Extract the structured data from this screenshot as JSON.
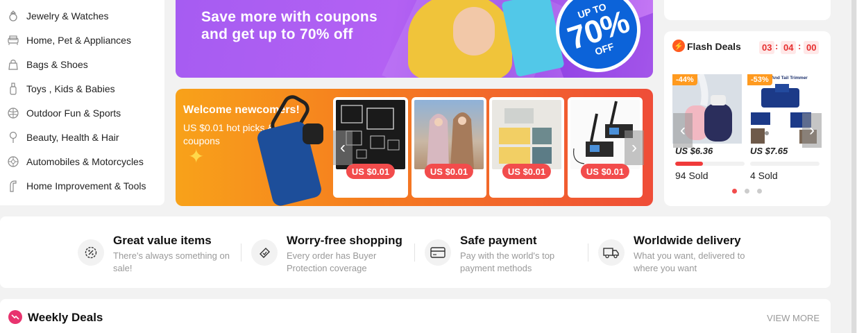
{
  "sidebar": {
    "categories": [
      {
        "label": "Jewelry & Watches",
        "icon": "ring-icon"
      },
      {
        "label": "Home, Pet & Appliances",
        "icon": "sofa-icon"
      },
      {
        "label": "Bags & Shoes",
        "icon": "bag-icon"
      },
      {
        "label": "Toys , Kids & Babies",
        "icon": "bottle-icon"
      },
      {
        "label": "Outdoor Fun & Sports",
        "icon": "ball-icon"
      },
      {
        "label": "Beauty, Health & Hair",
        "icon": "beauty-icon"
      },
      {
        "label": "Automobiles & Motorcycles",
        "icon": "wheel-icon"
      },
      {
        "label": "Home Improvement & Tools",
        "icon": "tool-icon"
      }
    ]
  },
  "hero": {
    "line1": "Save more with coupons",
    "line2": "and get up to 70% off",
    "badge_upto": "UP TO",
    "badge_pct": "70%",
    "badge_off": "OFF"
  },
  "welcome": {
    "title": "Welcome newcomers!",
    "subtitle": "US $0.01 hot picks & coupons",
    "products": [
      {
        "price": "US $0.01",
        "image": "acrylic-boxes"
      },
      {
        "price": "US $0.01",
        "image": "hijab-scarves"
      },
      {
        "price": "US $0.01",
        "image": "storage-boxes"
      },
      {
        "price": "US $0.01",
        "image": "lora-board"
      }
    ]
  },
  "flash": {
    "title": "Flash Deals",
    "timer": {
      "h": "03",
      "m": "04",
      "s": "00"
    },
    "items": [
      {
        "discount": "-44%",
        "price": "US $6.36",
        "sold": "94 Sold",
        "progress": 0.4,
        "image": "humidifier"
      },
      {
        "discount": "-53%",
        "price": "US $7.65",
        "sold": "4 Sold",
        "progress": 0.0,
        "image": "head-tail-trimmer",
        "image_caption": "/ Head And Tail Trimmer"
      }
    ],
    "pages": 3,
    "active_page": 0
  },
  "benefits": [
    {
      "title": "Great value items",
      "desc": "There's always something on sale!",
      "icon": "price-tag-icon"
    },
    {
      "title": "Worry-free shopping",
      "desc": "Every order has Buyer Protection coverage",
      "icon": "shield-icon"
    },
    {
      "title": "Safe payment",
      "desc": "Pay with the world's top payment methods",
      "icon": "credit-card-icon"
    },
    {
      "title": "Worldwide delivery",
      "desc": "What you want, delivered to where you want",
      "icon": "truck-icon"
    }
  ],
  "weekly": {
    "title": "Weekly Deals",
    "more": "VIEW MORE"
  },
  "colors": {
    "accent_red": "#f24c4c",
    "flash_orange": "#ff5a1f",
    "weekly_pink": "#e8336e"
  }
}
